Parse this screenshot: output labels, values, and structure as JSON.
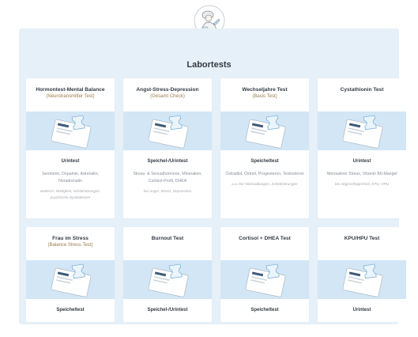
{
  "logo": {
    "icon": "lab-scientist-logo-icon"
  },
  "section_title": "Labortests",
  "tests": [
    {
      "title": "Hormontest-Mental Balance",
      "subtitle": "(Neurotransmitter Test)",
      "type": "Urintest",
      "desc": "Serotonin, Dopamin, Adrenalin, Noradrenalin",
      "note": "weiteres: Müdigkeit, Schlafstörungen, psychische Dysbalancen"
    },
    {
      "title": "Angst-Stress-Depression",
      "subtitle": "(Gesamt Check)",
      "type": "Speichel-/Urintest",
      "desc": "Stress- & Sexualhormone, Mineralien, Cortisol-Profil, DHEA",
      "note": "bei Angst, Stress, Depression"
    },
    {
      "title": "Wechseljahre Test",
      "subtitle": "(Basis Test)",
      "type": "Speicheltest",
      "desc": "Östradiol, Östriol, Progesteron, Testosteron",
      "note": "u.a. bei Hitzewallungen, Schlafstörungen"
    },
    {
      "title": "Cystathionin Test",
      "subtitle": "",
      "type": "Urintest",
      "desc": "Nitrosativer Stress, Vitamin B6-Mangel",
      "note": "bei Abgeschlagenheit, KPU, HPU"
    },
    {
      "title": "Frau im Stress",
      "subtitle": "(Balance Stress Test)",
      "type": "Speicheltest",
      "desc": "",
      "note": ""
    },
    {
      "title": "Burnout Test",
      "subtitle": "",
      "type": "Speichel-/Urintest",
      "desc": "",
      "note": ""
    },
    {
      "title": "Cortisol + DHEA Test",
      "subtitle": "",
      "type": "Speicheltest",
      "desc": "",
      "note": ""
    },
    {
      "title": "KPU/HPU Test",
      "subtitle": "",
      "type": "Urintest",
      "desc": "",
      "note": ""
    }
  ],
  "colors": {
    "panel": "#e6f0f8",
    "image_band": "#d3e6f5",
    "subtitle": "#9a7b4a",
    "title": "#333a44"
  }
}
